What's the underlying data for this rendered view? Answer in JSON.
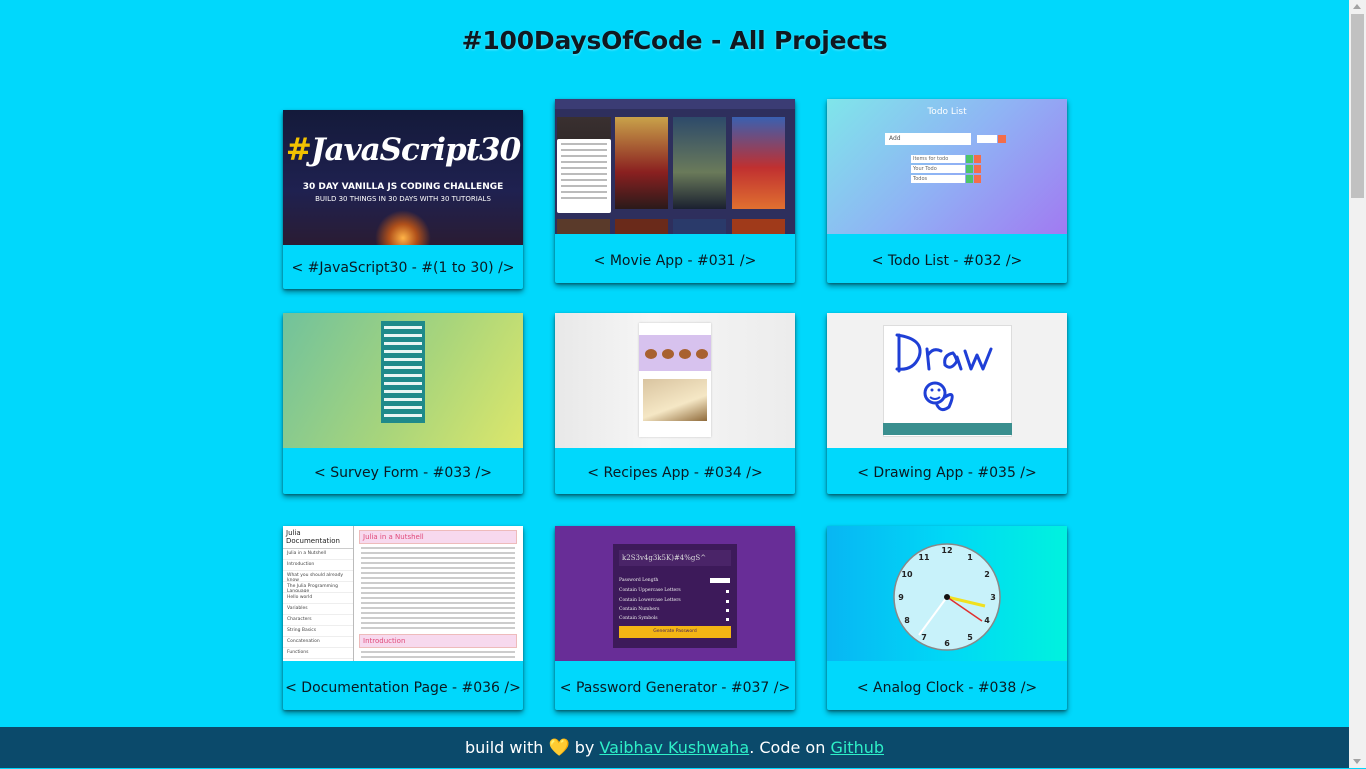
{
  "page": {
    "title": "#100DaysOfCode - All Projects"
  },
  "projects": [
    {
      "caption": "< #JavaScript30 - #(1 to 30) />",
      "thumb": {
        "headline": "JavaScript30",
        "hash": "#",
        "line1": "30 DAY VANILLA JS CODING CHALLENGE",
        "line2": "BUILD 30 THINGS IN 30 DAYS WITH 30 TUTORIALS"
      }
    },
    {
      "caption": "< Movie App - #031 />"
    },
    {
      "caption": "< Todo List - #032 />",
      "thumb": {
        "title": "Todo List",
        "input": "Add",
        "items": [
          "Items for todo",
          "Your Todo",
          "Todos"
        ]
      }
    },
    {
      "caption": "< Survey Form - #033 />"
    },
    {
      "caption": "< Recipes App - #034 />"
    },
    {
      "caption": "< Drawing App - #035 />"
    },
    {
      "caption": "< Documentation Page - #036 />",
      "thumb": {
        "sidebar_title": "Julia Documentation",
        "sidebar_items": [
          "Julia in a Nutshell",
          "Introduction",
          "What you should already know",
          "The Julia Programming Language",
          "Hello world",
          "Variables",
          "Characters",
          "String Basics",
          "Concatenation",
          "Functions"
        ],
        "heading1": "Julia in a Nutshell",
        "heading2": "Introduction"
      }
    },
    {
      "caption": "< Password Generator - #037 />",
      "thumb": {
        "password": "k2S3v4g3k5K)#4%gS^",
        "labels": [
          "Password Length",
          "Contain Uppercase Letters",
          "Contain Lowercase Letters",
          "Contain Numbers",
          "Contain Symbols"
        ],
        "button": "Generate Password"
      }
    },
    {
      "caption": "< Analog Clock - #038 />"
    }
  ],
  "footer": {
    "prefix": "build with",
    "heart": "💛",
    "by": "by",
    "author": "Vaibhav Kushwaha",
    "code_on": ". Code on",
    "github": "Github"
  },
  "colors": {
    "background": "#00d8fc",
    "footer_bg": "#0b4a6b",
    "link": "#2ef0c8"
  }
}
